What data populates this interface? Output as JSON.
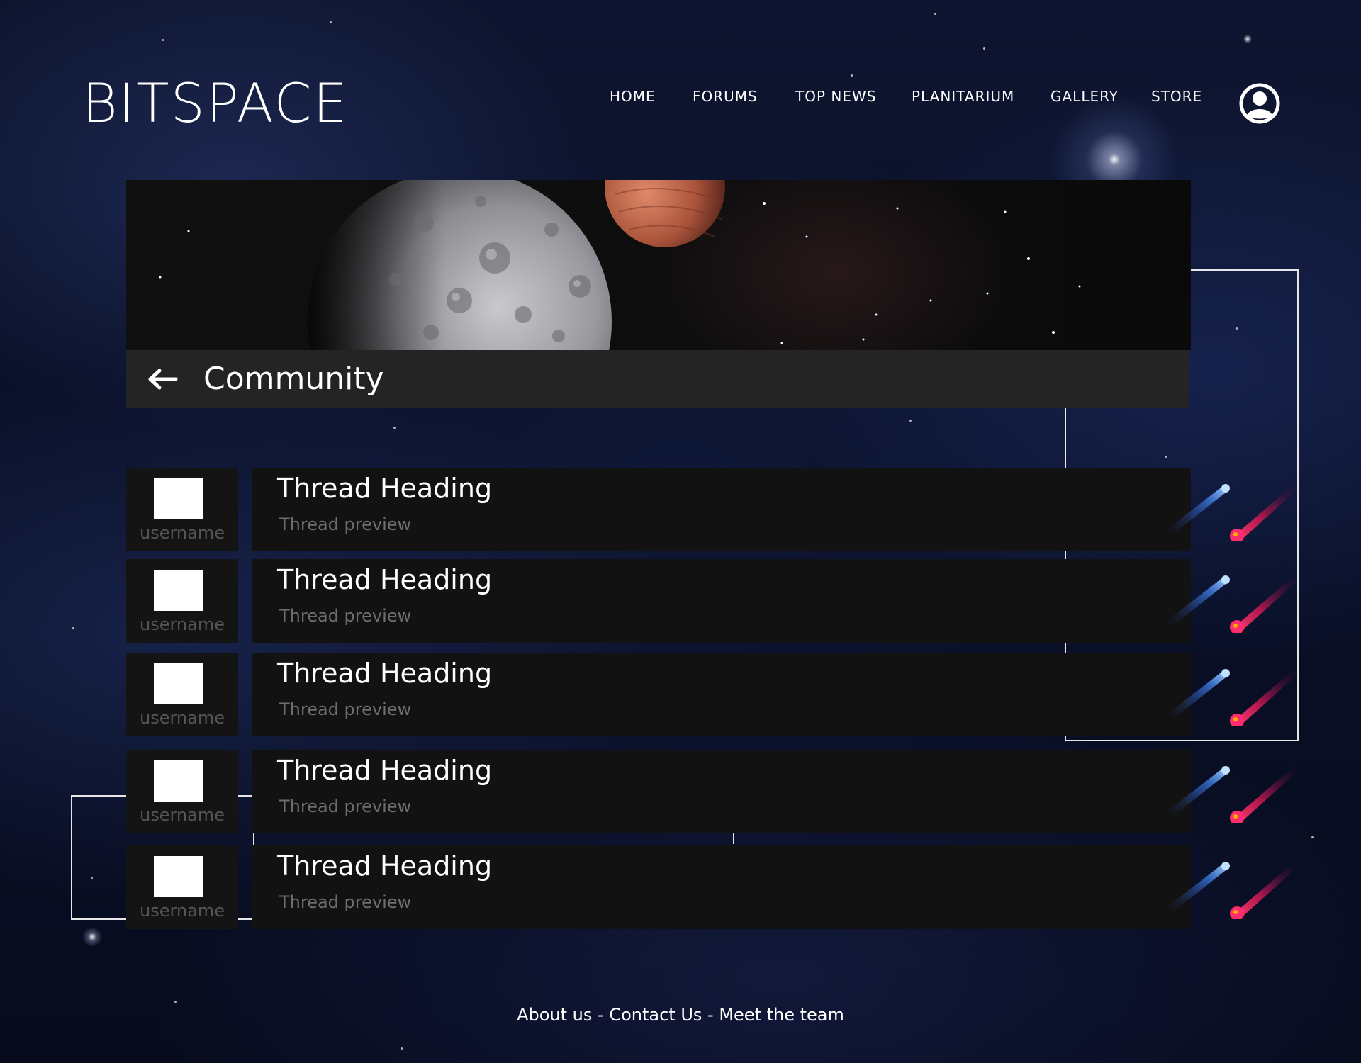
{
  "brand": {
    "logo_text": "BITSPACE"
  },
  "nav": {
    "items": [
      {
        "label": "HOME"
      },
      {
        "label": "FORUMS"
      },
      {
        "label": "TOP NEWS"
      },
      {
        "label": "PLANITARIUM"
      },
      {
        "label": "GALLERY"
      },
      {
        "label": "STORE"
      }
    ],
    "profile_icon": "user-circle-icon"
  },
  "page": {
    "title": "Community",
    "back_icon": "arrow-left-icon"
  },
  "threads": [
    {
      "username": "username",
      "heading": "Thread Heading",
      "preview": "Thread preview"
    },
    {
      "username": "username",
      "heading": "Thread Heading",
      "preview": "Thread preview"
    },
    {
      "username": "username",
      "heading": "Thread Heading",
      "preview": "Thread preview"
    },
    {
      "username": "username",
      "heading": "Thread Heading",
      "preview": "Thread preview"
    },
    {
      "username": "username",
      "heading": "Thread Heading",
      "preview": "Thread preview"
    }
  ],
  "footer": {
    "links": [
      {
        "label": "About us"
      },
      {
        "label": "Contact Us"
      },
      {
        "label": "Meet the team"
      }
    ],
    "separator": " - "
  },
  "colors": {
    "background": "#0b1022",
    "card": "#121212",
    "title_bar": "#242424",
    "comet_blue": "#5aa8ff",
    "comet_red": "#ff2d6e"
  }
}
